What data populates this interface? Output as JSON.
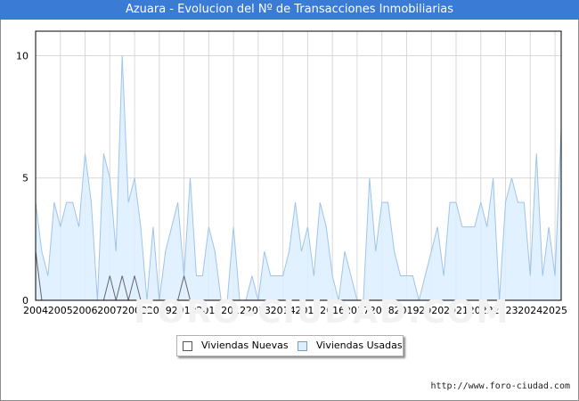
{
  "title": "Azuara - Evolucion del Nº de Transacciones Inmobiliarias",
  "footer": {
    "url": "http://www.foro-ciudad.com",
    "watermark": "FORO-CIUDAD.COM"
  },
  "colors": {
    "title_bg": "#3a7bd5",
    "usadas_fill": "#ddeeff",
    "usadas_line": "#9fc4e8",
    "nuevas_line": "#666666",
    "grid": "#d8d8d8"
  },
  "legend": {
    "nuevas": "Viviendas Nuevas",
    "usadas": "Viviendas Usadas"
  },
  "chart_data": {
    "type": "area",
    "title": "Azuara - Evolucion del Nº de Transacciones Inmobiliarias",
    "x_ticks": [
      "2004",
      "2005",
      "2006",
      "2007",
      "2008",
      "2009",
      "2010",
      "2011",
      "2012",
      "2013",
      "2014",
      "2015",
      "2016",
      "2017",
      "2018",
      "2019",
      "2020",
      "2021",
      "2022",
      "2023",
      "2024",
      "2025"
    ],
    "y_ticks": [
      0,
      5,
      10
    ],
    "ylim": [
      0,
      11
    ],
    "xlim": [
      2004,
      2025.25
    ],
    "grid": true,
    "legend_position": "bottom",
    "series": [
      {
        "name": "Viviendas Usadas",
        "start": 2004,
        "step": 0.25,
        "values": [
          4,
          2,
          1,
          4,
          3,
          4,
          4,
          3,
          6,
          4,
          0,
          6,
          5,
          2,
          10,
          4,
          5,
          3,
          0,
          3,
          0,
          2,
          3,
          4,
          1,
          5,
          1,
          1,
          3,
          2,
          0,
          0,
          3,
          0,
          0,
          1,
          0,
          2,
          1,
          1,
          1,
          2,
          4,
          2,
          3,
          1,
          4,
          3,
          1,
          0,
          2,
          1,
          0,
          0,
          5,
          2,
          4,
          4,
          2,
          1,
          1,
          1,
          0,
          1,
          2,
          3,
          1,
          4,
          4,
          3,
          3,
          3,
          4,
          3,
          5,
          0,
          4,
          5,
          4,
          4,
          1,
          6,
          1,
          3,
          1,
          7
        ]
      },
      {
        "name": "Viviendas Nuevas",
        "start": 2004,
        "step": 0.25,
        "values": [
          2,
          0,
          0,
          0,
          0,
          0,
          0,
          0,
          0,
          0,
          0,
          0,
          1,
          0,
          1,
          0,
          1,
          0,
          0,
          0,
          0,
          0,
          0,
          0,
          1,
          0,
          0,
          0,
          0,
          0,
          0,
          0,
          0,
          0,
          0,
          0,
          0,
          0,
          0,
          0,
          0,
          0,
          0,
          0,
          0,
          0,
          0,
          0,
          0,
          0,
          0,
          0,
          0,
          0,
          0,
          0,
          0,
          0,
          0,
          0,
          0,
          0,
          0,
          0,
          0,
          0,
          0,
          0,
          0,
          0,
          0,
          0,
          0,
          0,
          0,
          0,
          0,
          0,
          0,
          0,
          0,
          0,
          0,
          0,
          0,
          0
        ]
      }
    ]
  }
}
